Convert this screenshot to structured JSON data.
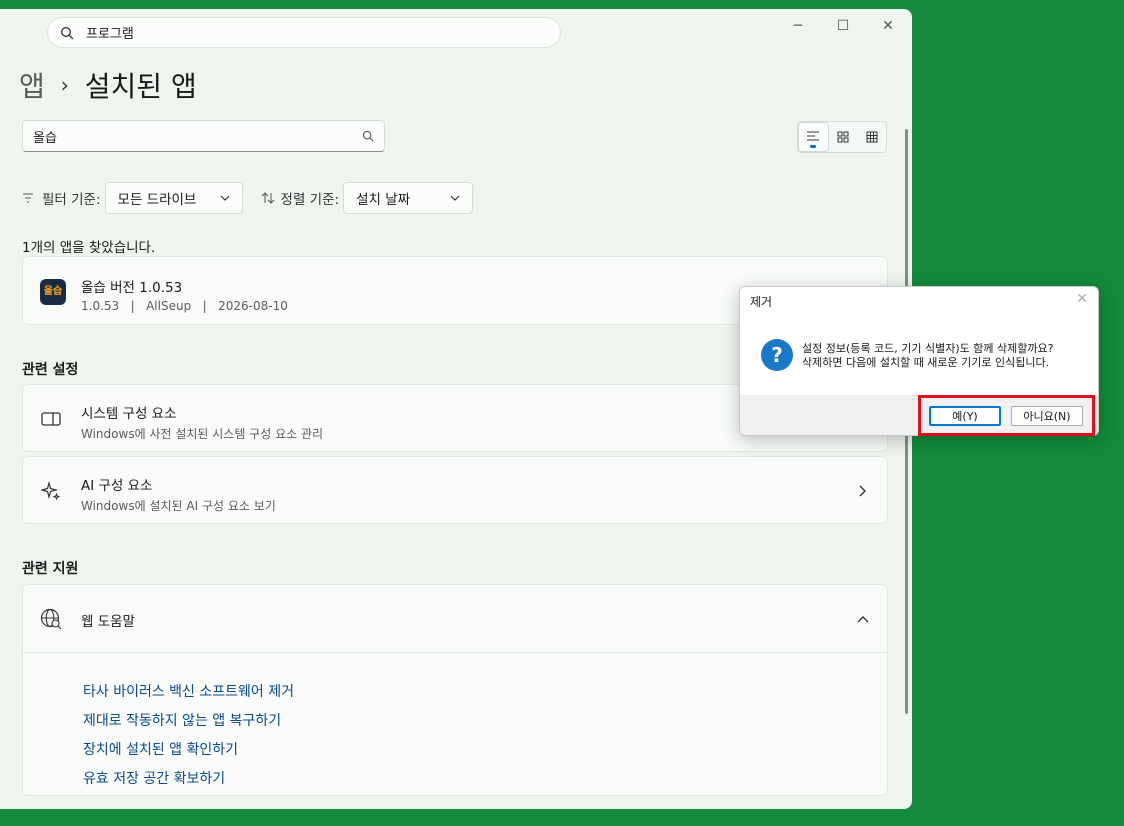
{
  "window": {
    "search_value": "프로그램",
    "controls": {
      "minimize": "─",
      "maximize": "☐",
      "close": "✕"
    }
  },
  "breadcrumb": {
    "root": "앱",
    "separator": "›",
    "current": "설치된 앱"
  },
  "app_search": {
    "value": "올습"
  },
  "filter": {
    "filter_label": "필터 기준:",
    "filter_value": "모든 드라이브",
    "sort_label": "정렬 기준:",
    "sort_value": "설치 날짜"
  },
  "result_text": "1개의 앱을 찾았습니다.",
  "app_item": {
    "icon_text": "올습",
    "name": "올습 버전 1.0.53",
    "details": "1.0.53   |   AllSeup   |   2026-08-10"
  },
  "related_settings": {
    "heading": "관련 설정",
    "items": [
      {
        "title": "시스템 구성 요소",
        "subtitle": "Windows에 사전 설치된 시스템 구성 요소 관리"
      },
      {
        "title": "AI 구성 요소",
        "subtitle": "Windows에 설치된 AI 구성 요소 보기"
      }
    ]
  },
  "related_support": {
    "heading": "관련 지원",
    "web_help": "웹 도움말",
    "links": [
      "타사 바이러스 백신 소프트웨어 제거",
      "제대로 작동하지 않는 앱 복구하기",
      "장치에 설치된 앱 확인하기",
      "유효 저장 공간 확보하기"
    ]
  },
  "dialog": {
    "title": "제거",
    "message_line1": "설정 정보(등록 코드, 기기 식별자)도 함께 삭제할까요?",
    "message_line2": "삭제하면 다음에 설치할 때 새로운 기기로 인식됩니다.",
    "yes_label": "예(Y)",
    "no_label": "아니요(N)",
    "icon_glyph": "?"
  },
  "colors": {
    "desktop": "#138a3c",
    "window_bg": "#eef5ef",
    "link": "#0b4a8c",
    "highlight": "#e0101f",
    "accent": "#0067c0"
  }
}
